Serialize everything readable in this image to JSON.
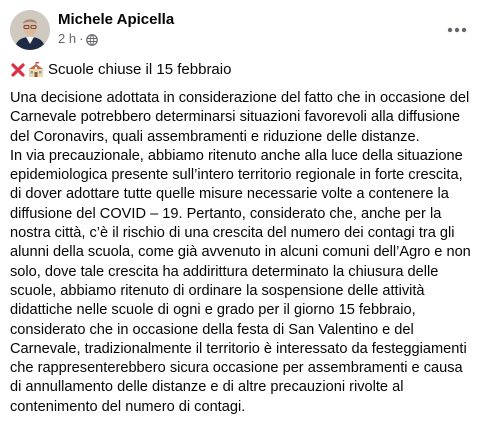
{
  "post": {
    "author": "Michele Apicella",
    "time": "2 h",
    "separator": "·",
    "privacy_icon": "globe-icon",
    "more_icon": "more-options-icon",
    "title_icons": [
      "red-cross-icon",
      "school-icon"
    ],
    "title": "Scuole chiuse il 15 febbraio",
    "paragraphs": [
      "Una decisione adottata in considerazione del fatto che in occasione del Carnevale potrebbero determinarsi situazioni favorevoli alla diffusione del Coronavirs, quali assembramenti e riduzione delle distanze.",
      "In via precauzionale, abbiamo ritenuto anche alla luce della situazione epidemiologica presente sull’intero territorio regionale in forte crescita, di dover adottare tutte quelle misure necessarie volte a contenere la diffusione del COVID – 19. Pertanto, considerato che, anche per la nostra città, c’è il rischio di una crescita del numero dei contagi tra gli alunni della scuola, come già avvenuto in alcuni comuni dell’Agro e non solo, dove tale crescita ha addirittura determinato la chiusura delle scuole, abbiamo ritenuto di ordinare la sospensione delle attività didattiche nelle scuole di ogni e grado per il giorno 15 febbraio, considerato che in occasione della festa di San Valentino e del Carnevale, tradizionalmente il territorio è interessato da festeggiamenti che rappresenterebbero sicura occasione per assembramenti e causa di annullamento delle distanze e di altre precauzioni rivolte al contenimento del numero di contagi."
    ]
  }
}
